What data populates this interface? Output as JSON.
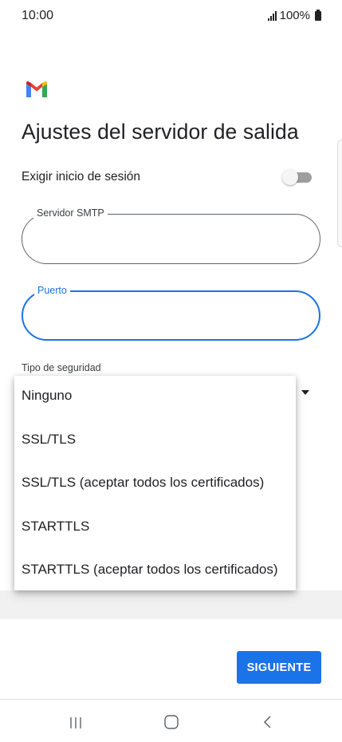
{
  "status_bar": {
    "time": "10:00",
    "battery_text": "100%",
    "icons": [
      "signal-icon",
      "battery-icon"
    ]
  },
  "app": {
    "logo_icon": "gmail-logo-icon",
    "title": "Ajustes del servidor de salida"
  },
  "form": {
    "require_signin": {
      "label": "Exigir inicio de sesión",
      "enabled": false
    },
    "smtp_server": {
      "label": "Servidor SMTP",
      "value": ""
    },
    "port": {
      "label": "Puerto",
      "value": "",
      "focused": true
    },
    "security_type": {
      "label": "Tipo de seguridad",
      "options": [
        "Ninguno",
        "SSL/TLS",
        "SSL/TLS (aceptar todos los certificados)",
        "STARTTLS",
        "STARTTLS (aceptar todos los certificados)"
      ]
    }
  },
  "actions": {
    "next_label": "SIGUIENTE"
  },
  "nav_bar": {
    "icons": [
      "recents-icon",
      "home-icon",
      "back-icon"
    ]
  },
  "colors": {
    "accent": "#1a73e8",
    "text": "#202124",
    "outline": "#5f6368",
    "toggle_off": "#9e9e9e"
  }
}
